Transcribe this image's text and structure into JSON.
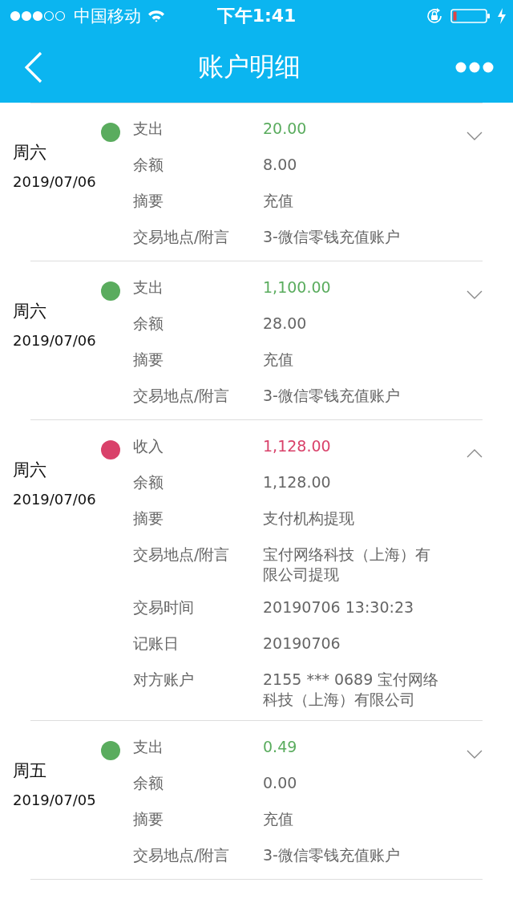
{
  "status_bar": {
    "carrier": "中国移动",
    "time": "下午1:41"
  },
  "nav": {
    "title": "账户明细"
  },
  "entries": [
    {
      "weekday": "周六",
      "date": "2019/07/06",
      "color": "#5aac5e",
      "expanded": false,
      "fields": [
        {
          "label": "支出",
          "value": "20.00"
        },
        {
          "label": "余额",
          "value": "8.00"
        },
        {
          "label": "摘要",
          "value": "充值"
        },
        {
          "label": "交易地点/附言",
          "value": "3-微信零钱充值账户"
        }
      ]
    },
    {
      "weekday": "周六",
      "date": "2019/07/06",
      "color": "#5aac5e",
      "expanded": false,
      "fields": [
        {
          "label": "支出",
          "value": "1,100.00"
        },
        {
          "label": "余额",
          "value": "28.00"
        },
        {
          "label": "摘要",
          "value": "充值"
        },
        {
          "label": "交易地点/附言",
          "value": "3-微信零钱充值账户"
        }
      ]
    },
    {
      "weekday": "周六",
      "date": "2019/07/06",
      "color": "#d9416a",
      "expanded": true,
      "fields": [
        {
          "label": "收入",
          "value": "1,128.00"
        },
        {
          "label": "余额",
          "value": "1,128.00"
        },
        {
          "label": "摘要",
          "value": "支付机构提现"
        },
        {
          "label": "交易地点/附言",
          "value": "宝付网络科技（上海）有限公司提现"
        },
        {
          "label": "交易时间",
          "value": "20190706 13:30:23"
        },
        {
          "label": "记账日",
          "value": "20190706"
        },
        {
          "label": "对方账户",
          "value": "2155 *** 0689 宝付网络科技（上海）有限公司"
        }
      ]
    },
    {
      "weekday": "周五",
      "date": "2019/07/05",
      "color": "#5aac5e",
      "expanded": false,
      "fields": [
        {
          "label": "支出",
          "value": "0.49"
        },
        {
          "label": "余额",
          "value": "0.00"
        },
        {
          "label": "摘要",
          "value": "充值"
        },
        {
          "label": "交易地点/附言",
          "value": "3-微信零钱充值账户"
        }
      ]
    }
  ]
}
